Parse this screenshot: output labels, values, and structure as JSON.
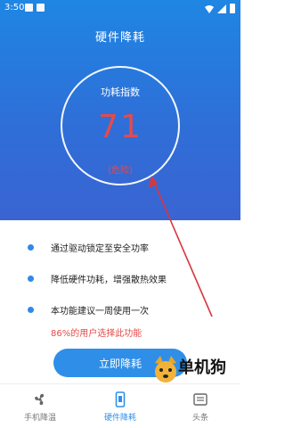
{
  "status_bar": {
    "time": "3:50"
  },
  "header": {
    "title": "硬件降耗"
  },
  "gauge": {
    "label": "功耗指数",
    "value": "71",
    "status": "(危险)"
  },
  "features": [
    {
      "text": "通过驱动锁定至安全功率"
    },
    {
      "text": "降低硬件功耗，增强散热效果"
    },
    {
      "text": "本功能建议一周使用一次"
    }
  ],
  "usage_note": "86%的用户选择此功能",
  "primary_button": {
    "label": "立即降耗"
  },
  "bottom_nav": [
    {
      "label": "手机降温",
      "icon": "fan-icon"
    },
    {
      "label": "硬件降耗",
      "icon": "phone-icon"
    },
    {
      "label": "头条",
      "icon": "news-icon"
    }
  ],
  "watermark": {
    "text": "单机狗",
    "icon": "dog-logo"
  },
  "colors": {
    "primary": "#2f8fe8",
    "danger": "#e64a4a",
    "header_top": "#1f86e3",
    "header_bottom": "#3a64d2"
  }
}
